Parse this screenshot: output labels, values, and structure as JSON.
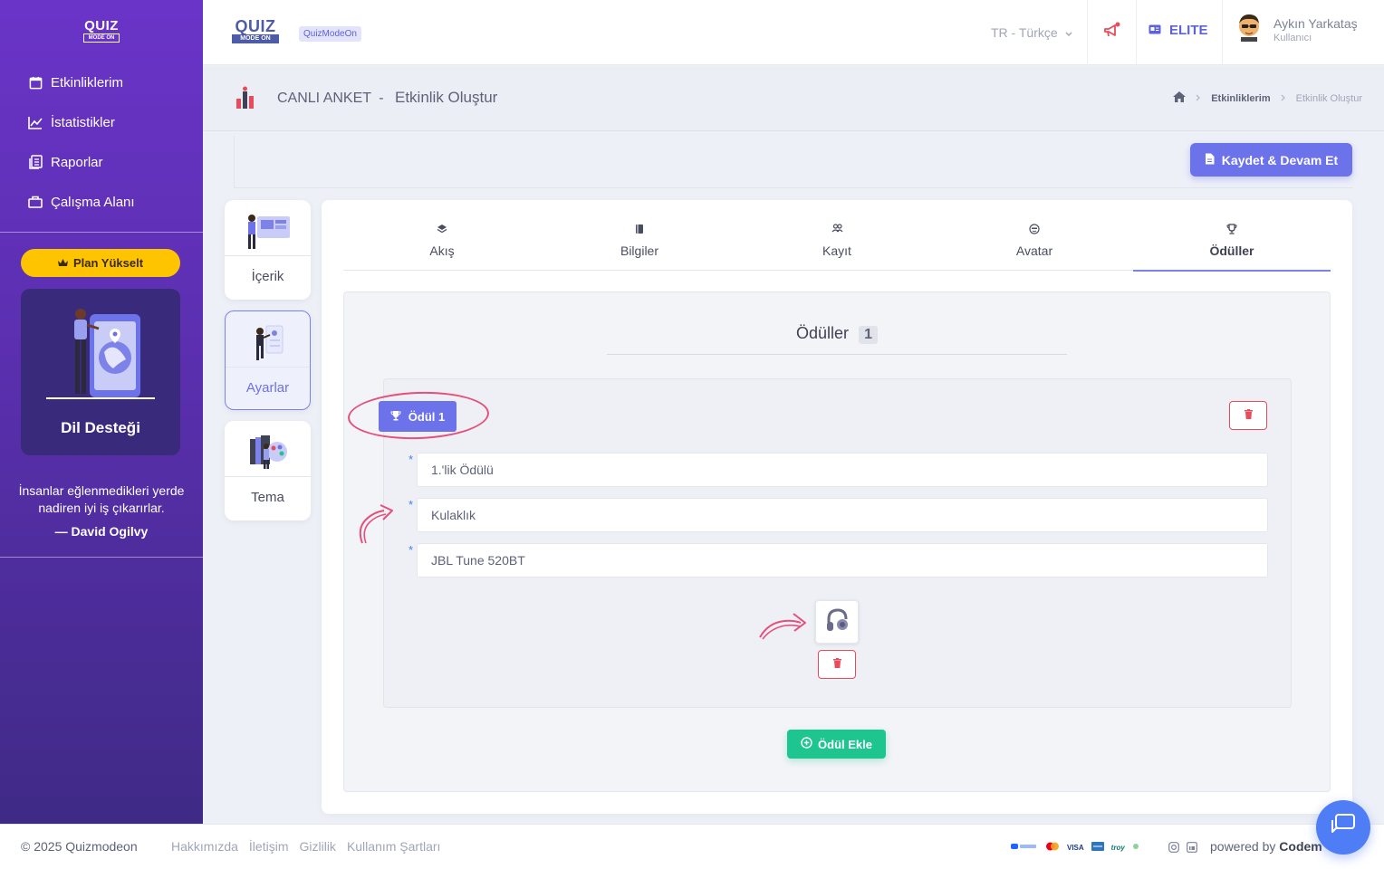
{
  "brand": {
    "logo_top": "QUIZ",
    "logo_bottom": "MODE ON",
    "tag": "QuizModeOn"
  },
  "sidebar": {
    "items": [
      {
        "label": "Etkinliklerim",
        "icon": "calendar-icon"
      },
      {
        "label": "İstatistikler",
        "icon": "chart-line-icon"
      },
      {
        "label": "Raporlar",
        "icon": "report-icon"
      },
      {
        "label": "Çalışma Alanı",
        "icon": "briefcase-icon"
      }
    ],
    "plan_button": "Plan Yükselt",
    "promo_title": "Dil Desteği",
    "quote_text": "İnsanlar eğlenmedikleri yerde nadiren iyi iş çıkarırlar.",
    "quote_author": "— David Ogilvy"
  },
  "header": {
    "language": "TR - Türkçe",
    "plan": "ELITE",
    "user_name": "Aykın Yarkataş",
    "user_role": "Kullanıcı"
  },
  "subheader": {
    "type": "CANLI ANKET",
    "separator": "-",
    "title": "Etkinlik Oluştur",
    "breadcrumb": [
      "Etkinliklerim",
      "Etkinlik Oluştur"
    ]
  },
  "save_button": "Kaydet & Devam Et",
  "steps": [
    "İçerik",
    "Ayarlar",
    "Tema"
  ],
  "tabs": [
    "Akış",
    "Bilgiler",
    "Kayıt",
    "Avatar",
    "Ödüller"
  ],
  "rewards": {
    "heading": "Ödüller",
    "count": "1",
    "badge": "Ödül 1",
    "fields": [
      "1.'lik Ödülü",
      "Kulaklık",
      "JBL Tune 520BT"
    ],
    "required_mark": "*",
    "add_button": "Ödül Ekle"
  },
  "footer": {
    "copyright": "© 2025 Quizmodeon",
    "links": [
      "Hakkımızda",
      "İletişim",
      "Gizlilik",
      "Kullanım Şartları"
    ],
    "payments": [
      "VISA",
      "troy"
    ],
    "powered_prefix": "powered by",
    "powered_name": "Codem"
  },
  "colors": {
    "accent": "#6b72ea",
    "sidebar": "#5a2fae",
    "success": "#1fc58f",
    "danger": "#e84c5b",
    "highlight": "#e4507a",
    "plan_yellow": "#ffc400"
  }
}
